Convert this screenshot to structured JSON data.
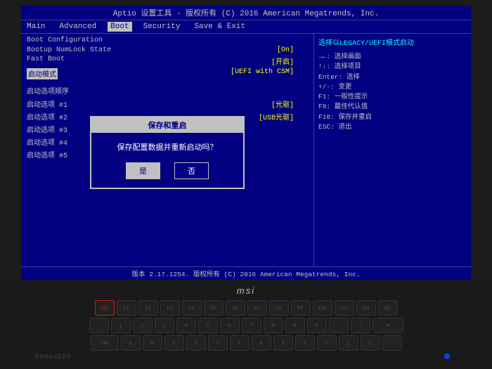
{
  "bios": {
    "header_title": "Aptio 设置工具 - 版权所有 (C) 2016 American Megatrends, Inc.",
    "footer_text": "版本 2.17.1254. 版权所有 (C) 2016 American Megatrends, Inc.",
    "menu_items": [
      {
        "label": "Main",
        "active": false
      },
      {
        "label": "Advanced",
        "active": false
      },
      {
        "label": "Boot",
        "active": true
      },
      {
        "label": "Security",
        "active": false
      },
      {
        "label": "Save & Exit",
        "active": false
      }
    ],
    "left_panel": {
      "section_title": "Boot Configuration",
      "rows": [
        {
          "label": "Bootup NumLock State",
          "value": "[On]"
        },
        {
          "label": "Fast Boot",
          "value": "[开启]"
        },
        {
          "label": "启动模式",
          "value": "[UEFI with CSM]",
          "highlighted": true
        }
      ],
      "boot_options_title": "启动选项顺序",
      "boot_options": [
        {
          "label": "启动选项 #1",
          "value": "[光驱]"
        },
        {
          "label": "启动选项 #2",
          "value": "[USB光驱]"
        },
        {
          "label": "启动选项 #3",
          "value": ""
        },
        {
          "label": "启动选项 #4",
          "value": ""
        },
        {
          "label": "启动选项 #5",
          "value": ""
        }
      ]
    },
    "right_panel": {
      "title": "选择以LEGACY/UEFI模式启动",
      "help_lines": [
        "→←: 选择画面",
        "↑↓: 选择项目",
        "Enter: 选择",
        "+/-: 变更",
        "F1: 一般性提示",
        "F9: 最佳代认值",
        "F10: 保存并重启",
        "ESC: 退出"
      ]
    },
    "dialog": {
      "title": "保存和重启",
      "message": "保存配置数据并重新启动吗？",
      "yes_label": "是",
      "no_label": "否"
    }
  },
  "laptop": {
    "brand": "msi",
    "dvnaudio": "DVNAUDIO"
  }
}
